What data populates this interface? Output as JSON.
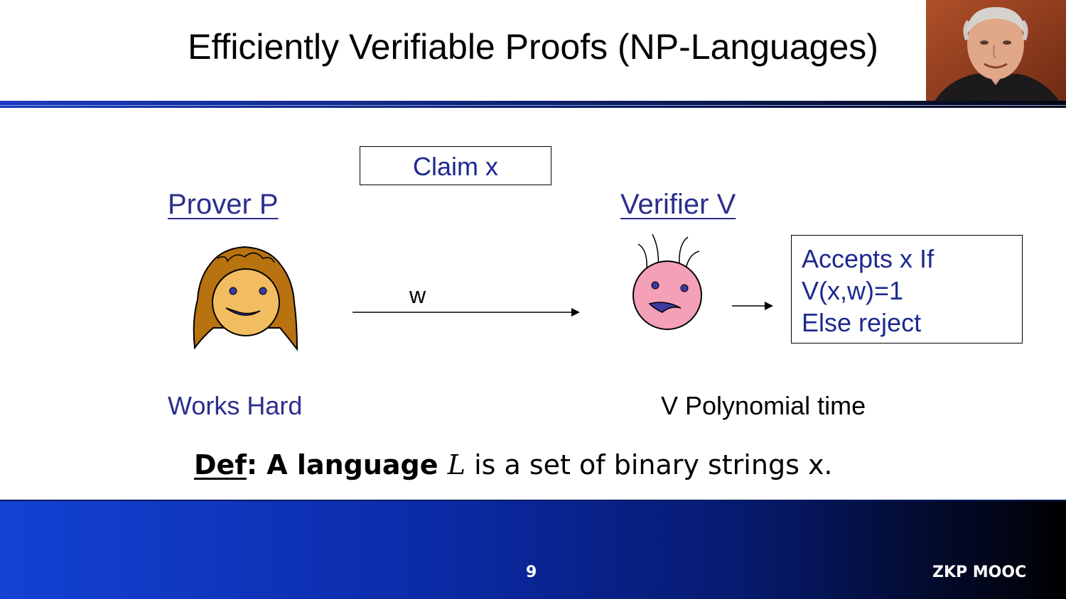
{
  "slide": {
    "title": "Efficiently Verifiable Proofs (NP-Languages)"
  },
  "diagram": {
    "claim": "Claim x",
    "prover_label": "Prover P",
    "verifier_label": "Verifier  V",
    "message_label": "w",
    "decision_lines": [
      "Accepts x  If",
      "V(x,w)=1",
      "Else reject"
    ],
    "prover_caption": "Works Hard",
    "verifier_caption": "V Polynomial time"
  },
  "definition": {
    "term": "Def",
    "colon": ":",
    "bold_text": " A language ",
    "variable": "L",
    "rest": " is a set of binary strings x."
  },
  "footer": {
    "page_number": "9",
    "course": "ZKP MOOC"
  },
  "colors": {
    "text_blue": "#1d2a8f",
    "label_blue": "#2b2f8c",
    "footer_blue": "#1442d4"
  }
}
